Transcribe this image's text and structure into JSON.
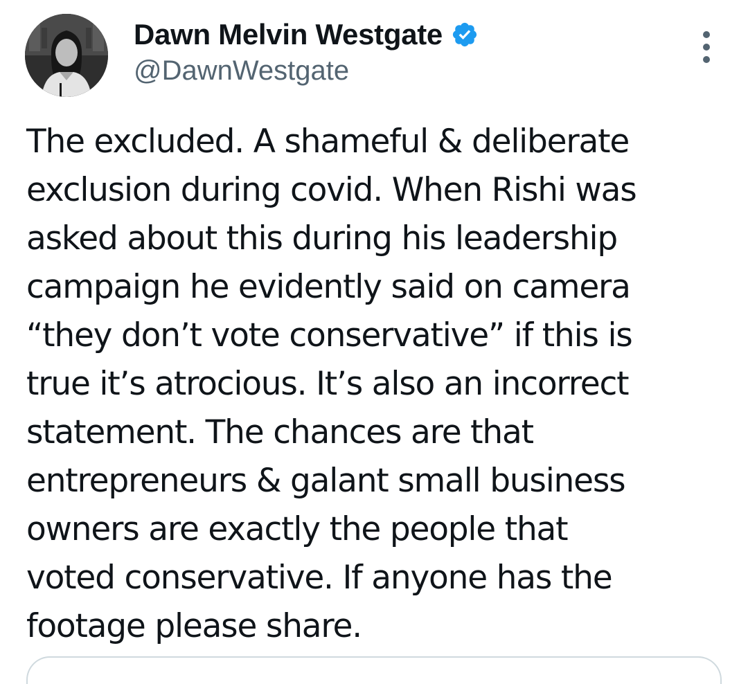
{
  "author": {
    "display_name": "Dawn Melvin Westgate",
    "handle": "@DawnWestgate",
    "verified": true,
    "verified_icon": "verified-badge-icon",
    "verified_color": "#1d9bf0"
  },
  "menu": {
    "more_icon": "more-vertical-icon"
  },
  "tweet": {
    "lines": [
      "The excluded. A shameful & deliberate",
      "exclusion during covid. When Rishi was",
      "asked about this during his leadership",
      "campaign he evidently said on camera",
      "“they don’t vote conservative” if this is",
      "true it’s atrocious. It’s also an incorrect",
      "statement. The chances are that",
      "entrepreneurs & galant small business",
      "owners are exactly the people that",
      "voted conservative. If anyone has the",
      "footage please share."
    ]
  },
  "colors": {
    "text_primary": "#0f1419",
    "text_secondary": "#536471",
    "border": "#cfd9de"
  }
}
